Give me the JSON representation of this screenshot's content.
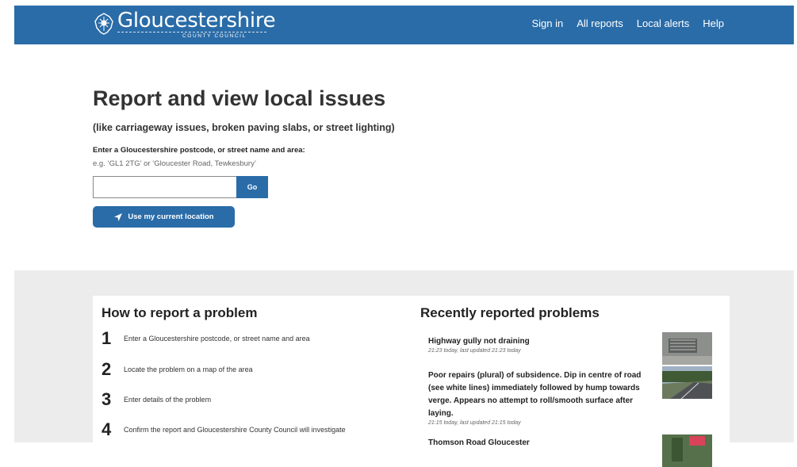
{
  "header": {
    "logo_text": "Gloucestershire",
    "logo_sub": "COUNTY COUNCIL",
    "nav": [
      "Sign in",
      "All reports",
      "Local alerts",
      "Help"
    ],
    "color": "#2a6ca8"
  },
  "hero": {
    "title": "Report and view local issues",
    "subtitle": "(like carriageway issues, broken paving slabs, or street lighting)",
    "search_label": "Enter a Gloucestershire postcode, or street name and area:",
    "search_hint": "e.g. ‘GL1 2TG’ or ‘Gloucester Road, Tewkesbury’",
    "search_value": "",
    "go_label": "Go",
    "location_label": "Use my current location"
  },
  "how": {
    "title": "How to report a problem",
    "steps": [
      {
        "num": "1",
        "text": "Enter a Gloucestershire postcode, or street name and area"
      },
      {
        "num": "2",
        "text": "Locate the problem on a map of the area"
      },
      {
        "num": "3",
        "text": "Enter details of the problem"
      },
      {
        "num": "4",
        "text": "Confirm the report and Gloucestershire County Council will investigate"
      }
    ]
  },
  "recent": {
    "title": "Recently reported problems",
    "problems": [
      {
        "title": "Highway gully not draining",
        "meta": "21:23 today, last updated 21:23 today"
      },
      {
        "title": "Poor repairs (plural) of subsidence. Dip in centre of road (see white lines) immediately followed by hump towards verge. Appears no attempt to roll/smooth surface after laying.",
        "meta": "21:15 today, last updated 21:15 today"
      },
      {
        "title": "Thomson Road Gloucester",
        "meta": ""
      }
    ]
  }
}
